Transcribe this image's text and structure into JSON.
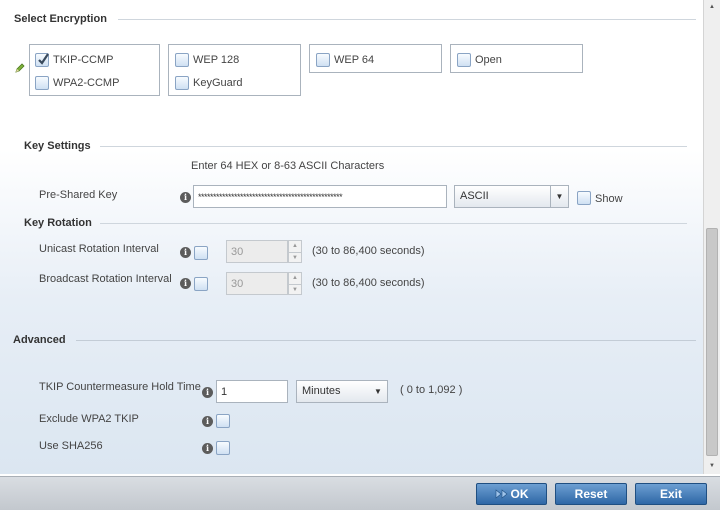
{
  "encryption": {
    "title": "Select Encryption",
    "options": [
      {
        "label": "TKIP-CCMP",
        "checked": true
      },
      {
        "label": "WPA2-CCMP",
        "checked": false
      },
      {
        "label": "WEP 128",
        "checked": false
      },
      {
        "label": "KeyGuard",
        "checked": false
      },
      {
        "label": "WEP 64",
        "checked": false
      },
      {
        "label": "Open",
        "checked": false
      }
    ]
  },
  "key_settings": {
    "title": "Key Settings",
    "hint": "Enter 64 HEX or 8-63 ASCII Characters",
    "psk_label": "Pre-Shared Key",
    "psk_value": "************************************************",
    "format_selected": "ASCII",
    "show_label": "Show",
    "show_checked": false
  },
  "key_rotation": {
    "title": "Key Rotation",
    "unicast_label": "Unicast Rotation Interval",
    "unicast_value": "30",
    "unicast_range": "(30 to 86,400 seconds)",
    "broadcast_label": "Broadcast Rotation Interval",
    "broadcast_value": "30",
    "broadcast_range": "(30 to 86,400 seconds)"
  },
  "advanced": {
    "title": "Advanced",
    "tkip_hold_label": "TKIP Countermeasure Hold Time",
    "tkip_hold_value": "1",
    "tkip_hold_unit": "Minutes",
    "tkip_hold_range": "( 0 to 1,092 )",
    "exclude_wpa2_label": "Exclude WPA2 TKIP",
    "use_sha256_label": "Use SHA256"
  },
  "footer": {
    "ok_label": "OK",
    "reset_label": "Reset",
    "exit_label": "Exit"
  },
  "icons": {
    "info": "i",
    "edit": "pencil-icon",
    "ok": "double-arrow-icon"
  },
  "colors": {
    "button": "#2e67a6",
    "checkbox_border": "#8aa4c4",
    "check_mark": "#3a4a5c"
  }
}
